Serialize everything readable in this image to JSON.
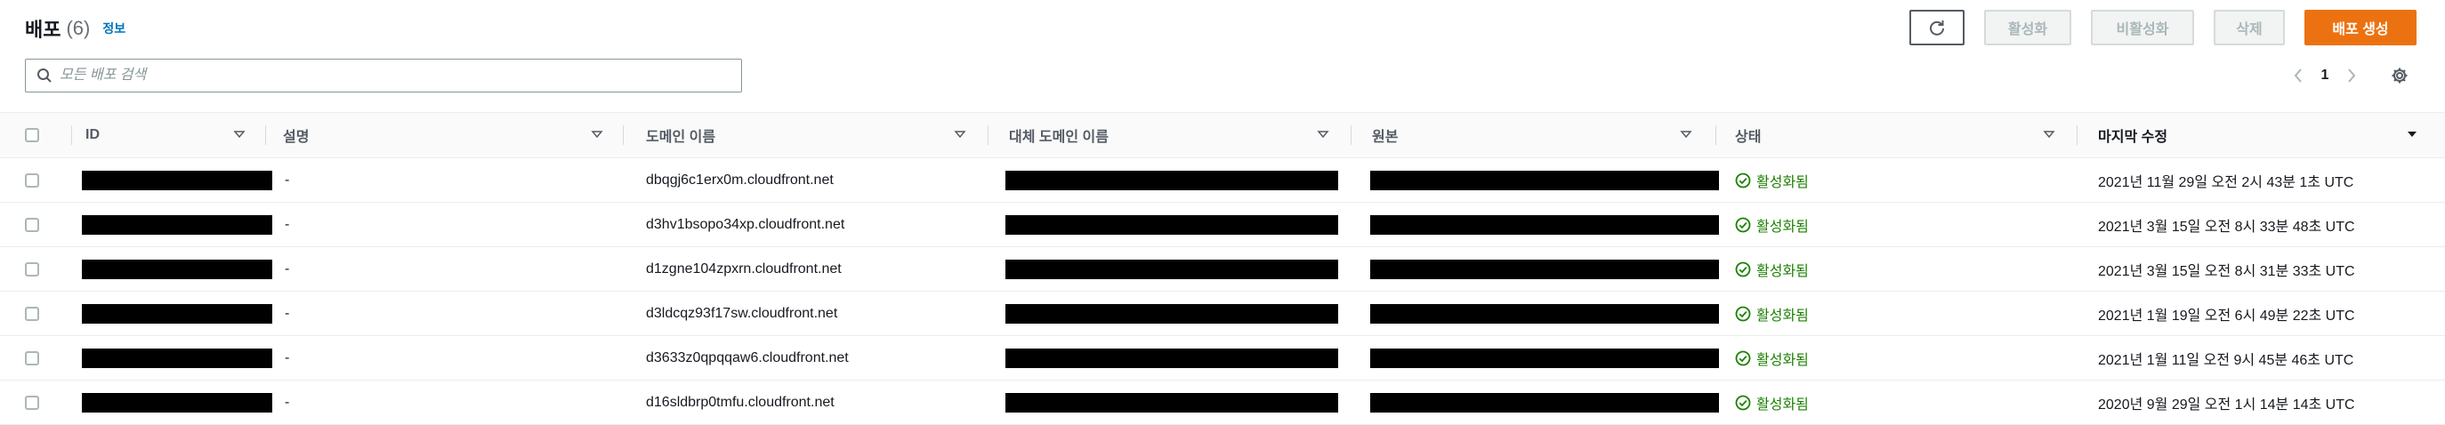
{
  "header": {
    "title": "배포",
    "count": "(6)",
    "info_link": "정보"
  },
  "actions": {
    "refresh_icon": "refresh-icon",
    "enable": "활성화",
    "disable": "비활성화",
    "delete": "삭제",
    "create": "배포 생성"
  },
  "search": {
    "placeholder": "모든 배포 검색",
    "value": ""
  },
  "pagination": {
    "current_page": "1"
  },
  "table": {
    "columns": [
      "ID",
      "설명",
      "도메인 이름",
      "대체 도메인 이름",
      "원본",
      "상태",
      "마지막 수정"
    ],
    "rows": [
      {
        "id": "",
        "description": "-",
        "domain": "dbqgj6c1erx0m.cloudfront.net",
        "alt_domain": "",
        "origin": "",
        "status": "활성화됨",
        "modified": "2021년 11월 29일 오전 2시 43분 1초 UTC"
      },
      {
        "id": "",
        "description": "-",
        "domain": "d3hv1bsopo34xp.cloudfront.net",
        "alt_domain": "",
        "origin": "",
        "status": "활성화됨",
        "modified": "2021년 3월 15일 오전 8시 33분 48초 UTC"
      },
      {
        "id": "",
        "description": "-",
        "domain": "d1zgne104zpxrn.cloudfront.net",
        "alt_domain": "",
        "origin": "",
        "status": "활성화됨",
        "modified": "2021년 3월 15일 오전 8시 31분 33초 UTC"
      },
      {
        "id": "",
        "description": "-",
        "domain": "d3ldcqz93f17sw.cloudfront.net",
        "alt_domain": "",
        "origin": "",
        "status": "활성화됨",
        "modified": "2021년 1월 19일 오전 6시 49분 22초 UTC"
      },
      {
        "id": "",
        "description": "-",
        "domain": "d3633z0qpqqaw6.cloudfront.net",
        "alt_domain": "",
        "origin": "",
        "status": "활성화됨",
        "modified": "2021년 1월 11일 오전 9시 45분 46초 UTC"
      },
      {
        "id": "",
        "description": "-",
        "domain": "d16sldbrp0tmfu.cloudfront.net",
        "alt_domain": "",
        "origin": "",
        "status": "활성화됨",
        "modified": "2020년 9월 29일 오전 1시 14분 14초 UTC"
      }
    ]
  },
  "colors": {
    "primary": "#ec7211",
    "status_green": "#1d8102",
    "link_blue": "#0073bb"
  }
}
